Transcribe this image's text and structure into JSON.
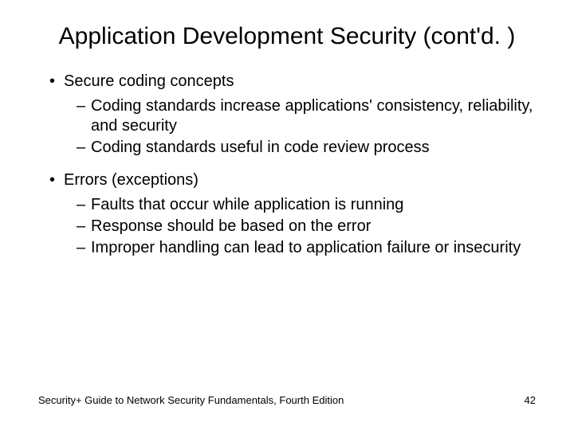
{
  "title": "Application Development Security (cont'd. )",
  "sections": [
    {
      "heading": "Secure coding concepts",
      "items": [
        "Coding standards increase applications' consistency, reliability, and security",
        "Coding standards useful in code review process"
      ]
    },
    {
      "heading": "Errors (exceptions)",
      "items": [
        "Faults that occur while application is running",
        "Response should be based on the error",
        "Improper handling can lead to application failure or insecurity"
      ]
    }
  ],
  "footer": {
    "source": "Security+ Guide to Network Security Fundamentals, Fourth Edition",
    "page": "42"
  }
}
